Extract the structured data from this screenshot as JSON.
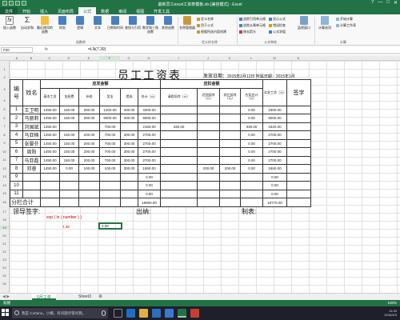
{
  "window": {
    "title": "最新员工excel工资表模板.xls  [兼容模式] - Excel",
    "controls": [
      "?",
      "—",
      "□",
      "✕"
    ]
  },
  "ribbon": {
    "tabs": [
      "文件",
      "开始",
      "插入",
      "页面布局",
      "公式",
      "数据",
      "审阅",
      "视图",
      "开发工具"
    ],
    "active_tab": "公式",
    "buttons": [
      {
        "label": "插入函数",
        "icon": "fx-icon"
      },
      {
        "label": "自动求和",
        "icon": "sigma-icon"
      },
      {
        "label": "最近使用的函数",
        "icon": "star-icon"
      },
      {
        "label": "财务",
        "icon": "book-icon"
      },
      {
        "label": "逻辑",
        "icon": "question-book-icon"
      },
      {
        "label": "文本",
        "icon": "text-book-icon"
      },
      {
        "label": "日期和时间",
        "icon": "clock-book-icon"
      },
      {
        "label": "查找与引用",
        "icon": "magnifier-book-icon"
      },
      {
        "label": "数学和三角函数",
        "icon": "theta-book-icon"
      },
      {
        "label": "其他函数",
        "icon": "more-book-icon"
      },
      {
        "label": "名称管理器",
        "icon": "tag-icon"
      }
    ],
    "defined_names": [
      "定义名称",
      "用于公式",
      "根据所选内容创建"
    ],
    "audit": [
      "追踪引用单元格",
      "追踪从属单元格",
      "移去箭头",
      "显示公式",
      "错误检查",
      "公式求值"
    ],
    "watch": "监视窗口",
    "calc": [
      "计算选项",
      "开始计算",
      "计算工作表"
    ],
    "groups": [
      "函数库",
      "定义的名称",
      "公式审核",
      "计算"
    ]
  },
  "formula_bar": {
    "name_box": "F20",
    "fx": "fx",
    "formula": "=LN(7.39)"
  },
  "columns": [
    "A",
    "B",
    "C",
    "D",
    "E",
    "F",
    "G",
    "H",
    "I",
    "J",
    "K",
    "L",
    "M",
    "N"
  ],
  "rows": [
    "1",
    "2",
    "3",
    "4",
    "5",
    "6",
    "7",
    "8",
    "9",
    "10",
    "11",
    "12",
    "13",
    "14",
    "15",
    "16",
    "17",
    "18",
    "19",
    "20",
    "21",
    "22",
    "23",
    "24",
    "25",
    "26",
    "27",
    "28",
    "29"
  ],
  "sheet": {
    "title": "员工工资表",
    "date_label": "发放日期：",
    "date_value": "2015年2月12日 所属日期：2015年1月",
    "headers": {
      "index": "编号",
      "name": "姓名",
      "payable": "应发金额",
      "deductions": "应扣金额",
      "actual": "实发工资（元）",
      "sign": "签字",
      "cols": [
        "基本工资",
        "加班费",
        "补助",
        "奖金",
        "提成",
        "合计（元）",
        "请假扣除（元）",
        "迟到扣除（元）",
        "其它扣除（元）",
        "应扣合计（元）"
      ]
    },
    "rows": [
      {
        "idx": "1",
        "name": "王卫明",
        "vals": [
          "1450.00",
          "150.00",
          "200.00",
          "1200.00",
          "300.00",
          "3300.00",
          "",
          "",
          "",
          "0.00",
          "3300.00"
        ]
      },
      {
        "idx": "2",
        "name": "马丽莉",
        "vals": [
          "1450.00",
          "150.00",
          "200.00",
          "9000.00",
          "300.00",
          "9000.00",
          "",
          "",
          "",
          "0.00",
          "9000.00"
        ]
      },
      {
        "idx": "3",
        "name": "刘国斌",
        "vals": [
          "1450.00",
          "",
          "",
          "700.00",
          "",
          "2150.00",
          "330.00",
          "",
          "",
          "330.00",
          "1820.00"
        ]
      },
      {
        "idx": "4",
        "name": "马亚楠",
        "vals": [
          "1450.00",
          "150.00",
          "200.00",
          "700.00",
          "300.00",
          "2700.00",
          "",
          "",
          "",
          "0.00",
          "2700.00"
        ]
      },
      {
        "idx": "5",
        "name": "张晏芬",
        "vals": [
          "1450.00",
          "150.00",
          "200.00",
          "700.00",
          "300.00",
          "2700.00",
          "",
          "",
          "",
          "0.00",
          "2700.00"
        ]
      },
      {
        "idx": "6",
        "name": "周阳",
        "vals": [
          "1450.00",
          "150.00",
          "200.00",
          "700.00",
          "300.00",
          "2700.00",
          "",
          "",
          "",
          "0.00",
          "2700.00"
        ]
      },
      {
        "idx": "7",
        "name": "马亚磊",
        "vals": [
          "1450.00",
          "150.00",
          "200.00",
          "700.00",
          "300.00",
          "2700.00",
          "",
          "",
          "",
          "0.00",
          "2700.00"
        ]
      },
      {
        "idx": "8",
        "name": "邓睿",
        "vals": [
          "1450.00",
          "0.00",
          "100.00",
          "100.00",
          "300.00",
          "1950.00",
          "",
          "200.00",
          "200.00",
          "0.00",
          "1650.00"
        ]
      },
      {
        "idx": "9",
        "name": "",
        "vals": [
          "",
          "",
          "",
          "",
          "",
          "0.00",
          "",
          "",
          "",
          "",
          "0.00"
        ]
      },
      {
        "idx": "10",
        "name": "",
        "vals": [
          "",
          "",
          "",
          "",
          "",
          "0.00",
          "",
          "",
          "",
          "",
          "0.00"
        ]
      },
      {
        "idx": "11",
        "name": "",
        "vals": [
          "",
          "",
          "",
          "",
          "",
          "0.00",
          "",
          "",
          "",
          "",
          "0.00"
        ]
      }
    ],
    "total_label": "分栏合计",
    "total_sum": "18900.00",
    "total_actual": "18770.00",
    "sign_labels": [
      "领导签字:",
      "出纳:",
      "制表:"
    ],
    "expression": "exp ( ln ( number ) )",
    "input_value": "7.39",
    "result_value": "2.00"
  },
  "sheet_tabs": {
    "tabs": [
      "5月工资",
      "Sheet3"
    ],
    "active": "5月工资",
    "add": "⊕"
  },
  "status": {
    "ready": "就绪",
    "zoom": "100%"
  },
  "taskbar": {
    "search_placeholder": "我是 Cortana，小娜。有问题尽管问我。",
    "time": "11:43",
    "date": "2016/4/3"
  },
  "colors": {
    "excel_green": "#217346",
    "red_text": "#c00000"
  }
}
